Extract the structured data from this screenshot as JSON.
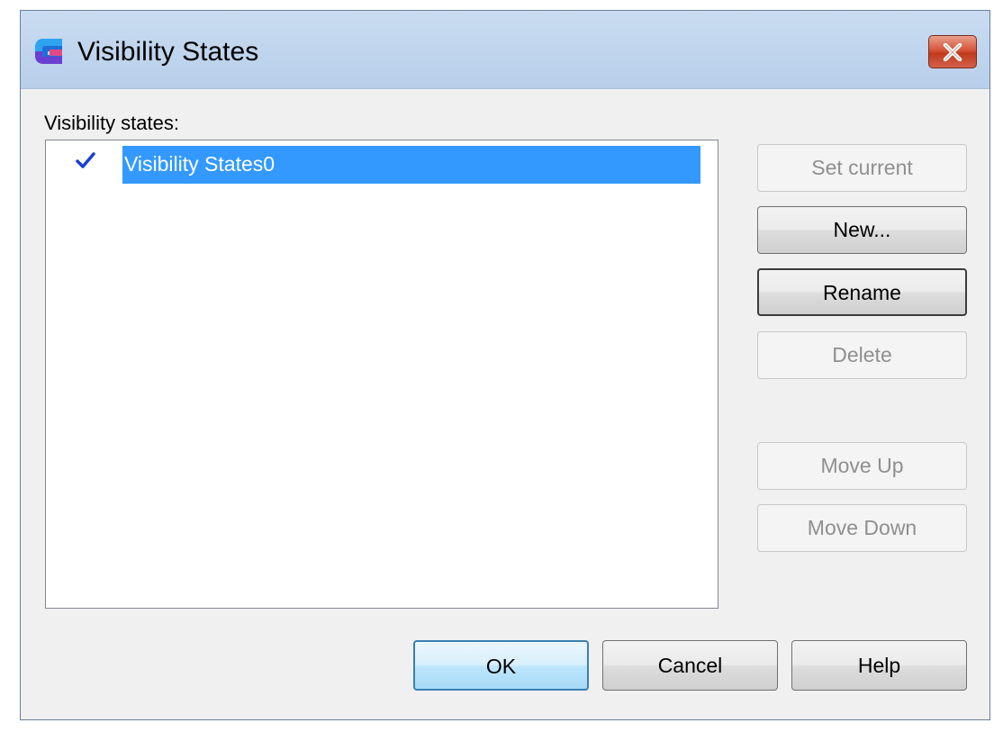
{
  "window": {
    "title": "Visibility States",
    "app_icon": "app-logo-icon",
    "close_icon": "close-icon",
    "close_color": "#c13a1d"
  },
  "list": {
    "label": "Visibility states:",
    "items": [
      {
        "label": "Visibility States0",
        "current": true,
        "selected": true,
        "marker_icon": "checkmark-icon"
      }
    ],
    "selection_color": "#3399ff"
  },
  "side_buttons": {
    "set_current": {
      "label": "Set current",
      "enabled": false
    },
    "new": {
      "label": "New...",
      "enabled": true
    },
    "rename": {
      "label": "Rename",
      "enabled": true
    },
    "delete": {
      "label": "Delete",
      "enabled": false
    },
    "move_up": {
      "label": "Move Up",
      "enabled": false
    },
    "move_down": {
      "label": "Move Down",
      "enabled": false
    }
  },
  "bottom_buttons": {
    "ok": {
      "label": "OK",
      "default": true
    },
    "cancel": {
      "label": "Cancel"
    },
    "help": {
      "label": "Help"
    }
  }
}
